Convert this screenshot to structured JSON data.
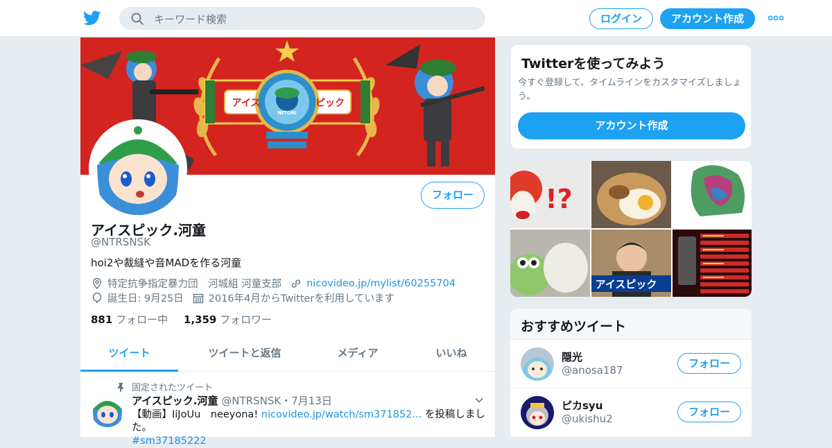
{
  "header": {
    "search_placeholder": "キーワード検索",
    "login_label": "ログイン",
    "signup_label": "アカウント作成"
  },
  "profile": {
    "follow_label": "フォロー",
    "name": "アイスピック.河童",
    "handle": "@NTRSNSK",
    "bio": "hoi2や裁縫や音MADを作る河童",
    "location": "特定抗争指定暴力団　河城組 河童支部",
    "website": "nicovideo.jp/mylist/60255704",
    "birthday": "誕生日: 9月25日",
    "joined": "2016年4月からTwitterを利用しています",
    "following_count": "881",
    "following_label": "フォロー中",
    "followers_count": "1,359",
    "followers_label": "フォロワー",
    "banner_text_left": "アイス",
    "banner_text_right": "ピック",
    "banner_emblem_text": "NITORI"
  },
  "tabs": [
    {
      "label": "ツイート",
      "active": true
    },
    {
      "label": "ツイートと返信",
      "active": false
    },
    {
      "label": "メディア",
      "active": false
    },
    {
      "label": "いいね",
      "active": false
    }
  ],
  "pinned_tweet": {
    "pinned_label": "固定されたツイート",
    "name": "アイスピック.河童",
    "handle": "@NTRSNSK",
    "date": "7月13日",
    "text_prefix": "【動画】IiJoUu　neeyona!",
    "link": "nicovideo.jp/watch/sm371852...",
    "text_suffix": "を投稿しました。",
    "hashtag": "#sm37185222"
  },
  "try_card": {
    "title": "Twitterを使ってみよう",
    "subtitle": "今すぐ登録して、タイムラインをカスタマイズしましょう。",
    "button": "アカウント作成"
  },
  "media_grid": {
    "caption_text": "アイスピック",
    "cell1_marks": "!?"
  },
  "recommended": {
    "title": "おすすめツイート",
    "users": [
      {
        "name": "隠光",
        "handle": "@anosa187",
        "button": "フォロー"
      },
      {
        "name": "ピカsyu",
        "handle": "@ukishu2",
        "button": "フォロー"
      }
    ]
  },
  "colors": {
    "accent": "#1da1f2",
    "link": "#1b95e0",
    "banner_red": "#d3241f",
    "muted": "#657786"
  }
}
